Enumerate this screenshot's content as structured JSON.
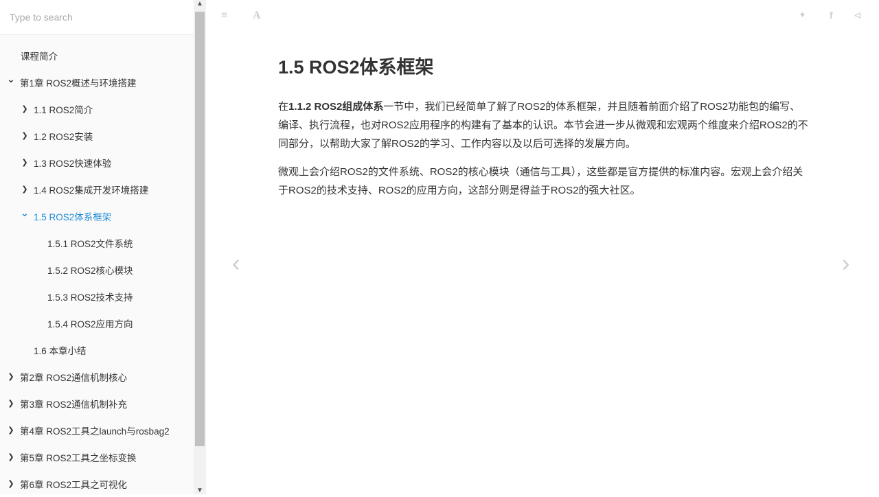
{
  "search": {
    "placeholder": "Type to search"
  },
  "toc": [
    {
      "label": "课程简介",
      "indent": 0,
      "chevron": ""
    },
    {
      "label": "第1章 ROS2概述与环境搭建",
      "indent": 0,
      "chevron": "down"
    },
    {
      "label": "1.1 ROS2简介",
      "indent": 1,
      "chevron": "right"
    },
    {
      "label": "1.2 ROS2安装",
      "indent": 1,
      "chevron": "right"
    },
    {
      "label": "1.3 ROS2快速体验",
      "indent": 1,
      "chevron": "right"
    },
    {
      "label": "1.4 ROS2集成开发环境搭建",
      "indent": 1,
      "chevron": "right"
    },
    {
      "label": "1.5 ROS2体系框架",
      "indent": 1,
      "chevron": "down",
      "active": true
    },
    {
      "label": "1.5.1 ROS2文件系统",
      "indent": 2,
      "chevron": ""
    },
    {
      "label": "1.5.2 ROS2核心模块",
      "indent": 2,
      "chevron": ""
    },
    {
      "label": "1.5.3 ROS2技术支持",
      "indent": 2,
      "chevron": ""
    },
    {
      "label": "1.5.4 ROS2应用方向",
      "indent": 2,
      "chevron": ""
    },
    {
      "label": "1.6 本章小结",
      "indent": 1,
      "chevron": ""
    },
    {
      "label": "第2章 ROS2通信机制核心",
      "indent": 0,
      "chevron": "right"
    },
    {
      "label": "第3章 ROS2通信机制补充",
      "indent": 0,
      "chevron": "right"
    },
    {
      "label": "第4章 ROS2工具之launch与rosbag2",
      "indent": 0,
      "chevron": "right"
    },
    {
      "label": "第5章 ROS2工具之坐标变换",
      "indent": 0,
      "chevron": "right"
    },
    {
      "label": "第6章 ROS2工具之可视化",
      "indent": 0,
      "chevron": "right"
    }
  ],
  "page": {
    "title": "1.5 ROS2体系框架",
    "p1_pre": "在",
    "p1_bold": "1.1.2 ROS2组成体系",
    "p1_post": "一节中，我们已经简单了解了ROS2的体系框架，并且随着前面介绍了ROS2功能包的编写、编译、执行流程，也对ROS2应用程序的构建有了基本的认识。本节会进一步从微观和宏观两个维度来介绍ROS2的不同部分，以帮助大家了解ROS2的学习、工作内容以及以后可选择的发展方向。",
    "p2": "微观上会介绍ROS2的文件系统、ROS2的核心模块（通信与工具），这些都是官方提供的标准内容。宏观上会介绍关于ROS2的技术支持、ROS2的应用方向，这部分则是得益于ROS2的强大社区。"
  },
  "colors": {
    "active": "#1f8dd6"
  }
}
